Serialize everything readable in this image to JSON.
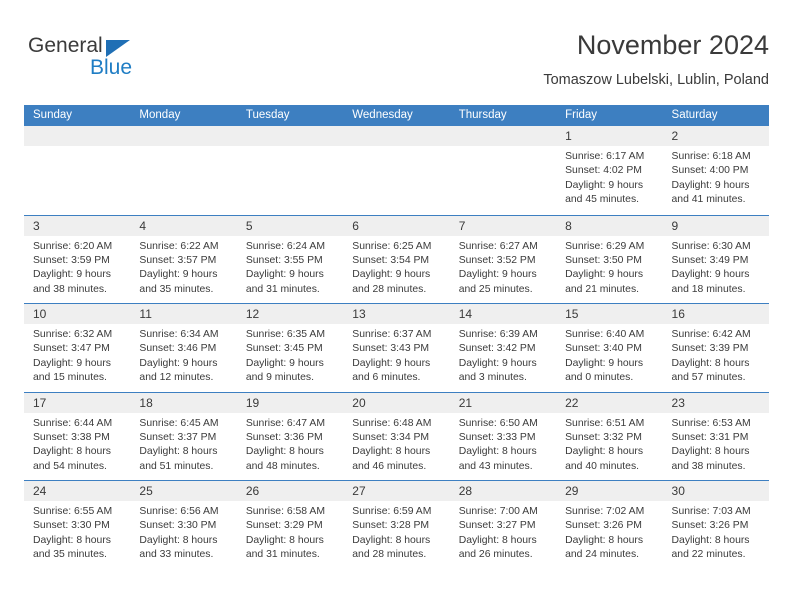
{
  "brand": {
    "name_part1": "General",
    "name_part2": "Blue",
    "triangle_color": "#1f6fb5",
    "blue_text_color": "#1f7dc4"
  },
  "header": {
    "title": "November 2024",
    "subtitle": "Tomaszow Lubelski, Lublin, Poland"
  },
  "theme": {
    "header_bar_color": "#3d7fc1",
    "day_strip_color": "#efefef",
    "text_color": "#3b3b3b"
  },
  "weekdays": [
    "Sunday",
    "Monday",
    "Tuesday",
    "Wednesday",
    "Thursday",
    "Friday",
    "Saturday"
  ],
  "weeks": [
    [
      {
        "day": "",
        "empty": true
      },
      {
        "day": "",
        "empty": true
      },
      {
        "day": "",
        "empty": true
      },
      {
        "day": "",
        "empty": true
      },
      {
        "day": "",
        "empty": true
      },
      {
        "day": "1",
        "sunrise": "Sunrise: 6:17 AM",
        "sunset": "Sunset: 4:02 PM",
        "daylight1": "Daylight: 9 hours",
        "daylight2": "and 45 minutes."
      },
      {
        "day": "2",
        "sunrise": "Sunrise: 6:18 AM",
        "sunset": "Sunset: 4:00 PM",
        "daylight1": "Daylight: 9 hours",
        "daylight2": "and 41 minutes."
      }
    ],
    [
      {
        "day": "3",
        "sunrise": "Sunrise: 6:20 AM",
        "sunset": "Sunset: 3:59 PM",
        "daylight1": "Daylight: 9 hours",
        "daylight2": "and 38 minutes."
      },
      {
        "day": "4",
        "sunrise": "Sunrise: 6:22 AM",
        "sunset": "Sunset: 3:57 PM",
        "daylight1": "Daylight: 9 hours",
        "daylight2": "and 35 minutes."
      },
      {
        "day": "5",
        "sunrise": "Sunrise: 6:24 AM",
        "sunset": "Sunset: 3:55 PM",
        "daylight1": "Daylight: 9 hours",
        "daylight2": "and 31 minutes."
      },
      {
        "day": "6",
        "sunrise": "Sunrise: 6:25 AM",
        "sunset": "Sunset: 3:54 PM",
        "daylight1": "Daylight: 9 hours",
        "daylight2": "and 28 minutes."
      },
      {
        "day": "7",
        "sunrise": "Sunrise: 6:27 AM",
        "sunset": "Sunset: 3:52 PM",
        "daylight1": "Daylight: 9 hours",
        "daylight2": "and 25 minutes."
      },
      {
        "day": "8",
        "sunrise": "Sunrise: 6:29 AM",
        "sunset": "Sunset: 3:50 PM",
        "daylight1": "Daylight: 9 hours",
        "daylight2": "and 21 minutes."
      },
      {
        "day": "9",
        "sunrise": "Sunrise: 6:30 AM",
        "sunset": "Sunset: 3:49 PM",
        "daylight1": "Daylight: 9 hours",
        "daylight2": "and 18 minutes."
      }
    ],
    [
      {
        "day": "10",
        "sunrise": "Sunrise: 6:32 AM",
        "sunset": "Sunset: 3:47 PM",
        "daylight1": "Daylight: 9 hours",
        "daylight2": "and 15 minutes."
      },
      {
        "day": "11",
        "sunrise": "Sunrise: 6:34 AM",
        "sunset": "Sunset: 3:46 PM",
        "daylight1": "Daylight: 9 hours",
        "daylight2": "and 12 minutes."
      },
      {
        "day": "12",
        "sunrise": "Sunrise: 6:35 AM",
        "sunset": "Sunset: 3:45 PM",
        "daylight1": "Daylight: 9 hours",
        "daylight2": "and 9 minutes."
      },
      {
        "day": "13",
        "sunrise": "Sunrise: 6:37 AM",
        "sunset": "Sunset: 3:43 PM",
        "daylight1": "Daylight: 9 hours",
        "daylight2": "and 6 minutes."
      },
      {
        "day": "14",
        "sunrise": "Sunrise: 6:39 AM",
        "sunset": "Sunset: 3:42 PM",
        "daylight1": "Daylight: 9 hours",
        "daylight2": "and 3 minutes."
      },
      {
        "day": "15",
        "sunrise": "Sunrise: 6:40 AM",
        "sunset": "Sunset: 3:40 PM",
        "daylight1": "Daylight: 9 hours",
        "daylight2": "and 0 minutes."
      },
      {
        "day": "16",
        "sunrise": "Sunrise: 6:42 AM",
        "sunset": "Sunset: 3:39 PM",
        "daylight1": "Daylight: 8 hours",
        "daylight2": "and 57 minutes."
      }
    ],
    [
      {
        "day": "17",
        "sunrise": "Sunrise: 6:44 AM",
        "sunset": "Sunset: 3:38 PM",
        "daylight1": "Daylight: 8 hours",
        "daylight2": "and 54 minutes."
      },
      {
        "day": "18",
        "sunrise": "Sunrise: 6:45 AM",
        "sunset": "Sunset: 3:37 PM",
        "daylight1": "Daylight: 8 hours",
        "daylight2": "and 51 minutes."
      },
      {
        "day": "19",
        "sunrise": "Sunrise: 6:47 AM",
        "sunset": "Sunset: 3:36 PM",
        "daylight1": "Daylight: 8 hours",
        "daylight2": "and 48 minutes."
      },
      {
        "day": "20",
        "sunrise": "Sunrise: 6:48 AM",
        "sunset": "Sunset: 3:34 PM",
        "daylight1": "Daylight: 8 hours",
        "daylight2": "and 46 minutes."
      },
      {
        "day": "21",
        "sunrise": "Sunrise: 6:50 AM",
        "sunset": "Sunset: 3:33 PM",
        "daylight1": "Daylight: 8 hours",
        "daylight2": "and 43 minutes."
      },
      {
        "day": "22",
        "sunrise": "Sunrise: 6:51 AM",
        "sunset": "Sunset: 3:32 PM",
        "daylight1": "Daylight: 8 hours",
        "daylight2": "and 40 minutes."
      },
      {
        "day": "23",
        "sunrise": "Sunrise: 6:53 AM",
        "sunset": "Sunset: 3:31 PM",
        "daylight1": "Daylight: 8 hours",
        "daylight2": "and 38 minutes."
      }
    ],
    [
      {
        "day": "24",
        "sunrise": "Sunrise: 6:55 AM",
        "sunset": "Sunset: 3:30 PM",
        "daylight1": "Daylight: 8 hours",
        "daylight2": "and 35 minutes."
      },
      {
        "day": "25",
        "sunrise": "Sunrise: 6:56 AM",
        "sunset": "Sunset: 3:30 PM",
        "daylight1": "Daylight: 8 hours",
        "daylight2": "and 33 minutes."
      },
      {
        "day": "26",
        "sunrise": "Sunrise: 6:58 AM",
        "sunset": "Sunset: 3:29 PM",
        "daylight1": "Daylight: 8 hours",
        "daylight2": "and 31 minutes."
      },
      {
        "day": "27",
        "sunrise": "Sunrise: 6:59 AM",
        "sunset": "Sunset: 3:28 PM",
        "daylight1": "Daylight: 8 hours",
        "daylight2": "and 28 minutes."
      },
      {
        "day": "28",
        "sunrise": "Sunrise: 7:00 AM",
        "sunset": "Sunset: 3:27 PM",
        "daylight1": "Daylight: 8 hours",
        "daylight2": "and 26 minutes."
      },
      {
        "day": "29",
        "sunrise": "Sunrise: 7:02 AM",
        "sunset": "Sunset: 3:26 PM",
        "daylight1": "Daylight: 8 hours",
        "daylight2": "and 24 minutes."
      },
      {
        "day": "30",
        "sunrise": "Sunrise: 7:03 AM",
        "sunset": "Sunset: 3:26 PM",
        "daylight1": "Daylight: 8 hours",
        "daylight2": "and 22 minutes."
      }
    ]
  ]
}
